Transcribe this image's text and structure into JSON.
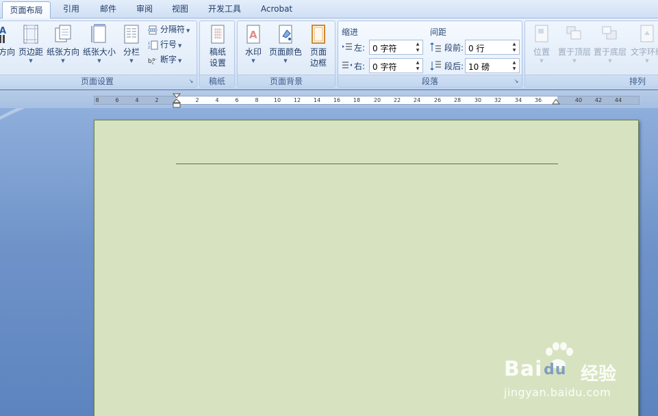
{
  "tabs": [
    "页面布局",
    "引用",
    "邮件",
    "审阅",
    "视图",
    "开发工具",
    "Acrobat"
  ],
  "groups": {
    "page_setup": {
      "label": "页面设置",
      "buttons": [
        "方向",
        "页边距",
        "纸张方向",
        "纸张大小",
        "分栏"
      ],
      "small": [
        "分隔符",
        "行号",
        "断字"
      ]
    },
    "manuscript": {
      "label": "稿纸",
      "button_line1": "稿纸",
      "button_line2": "设置"
    },
    "page_background": {
      "label": "页面背景",
      "watermark": "水印",
      "page_color": "页面颜色",
      "border_line1": "页面",
      "border_line2": "边框"
    },
    "paragraph": {
      "label": "段落",
      "indent_title": "缩进",
      "spacing_title": "间距",
      "left_label": "左:",
      "left_value": "0 字符",
      "right_label": "右:",
      "right_value": "0 字符",
      "before_label": "段前:",
      "before_value": "0 行",
      "after_label": "段后:",
      "after_value": "10 磅"
    },
    "arrange": {
      "label": "排列",
      "buttons": [
        "位置",
        "置于顶层",
        "置于底层",
        "文字环绕"
      ]
    }
  },
  "ruler": {
    "labels_left": [
      "8",
      "6",
      "4",
      "2"
    ],
    "labels_right": [
      "2",
      "4",
      "6",
      "8",
      "10",
      "12",
      "14",
      "16",
      "18",
      "20",
      "22",
      "24",
      "26",
      "28",
      "30",
      "32",
      "34",
      "36",
      "40",
      "42",
      "44"
    ]
  },
  "watermark": {
    "brand": "Bai",
    "brand_mid": "du",
    "brand_cn": "经验",
    "url": "jingyan.baidu.com"
  },
  "colors": {
    "page": "#d7e3c0",
    "accent": "#1e3a66",
    "workspace": "#6f93c9"
  }
}
